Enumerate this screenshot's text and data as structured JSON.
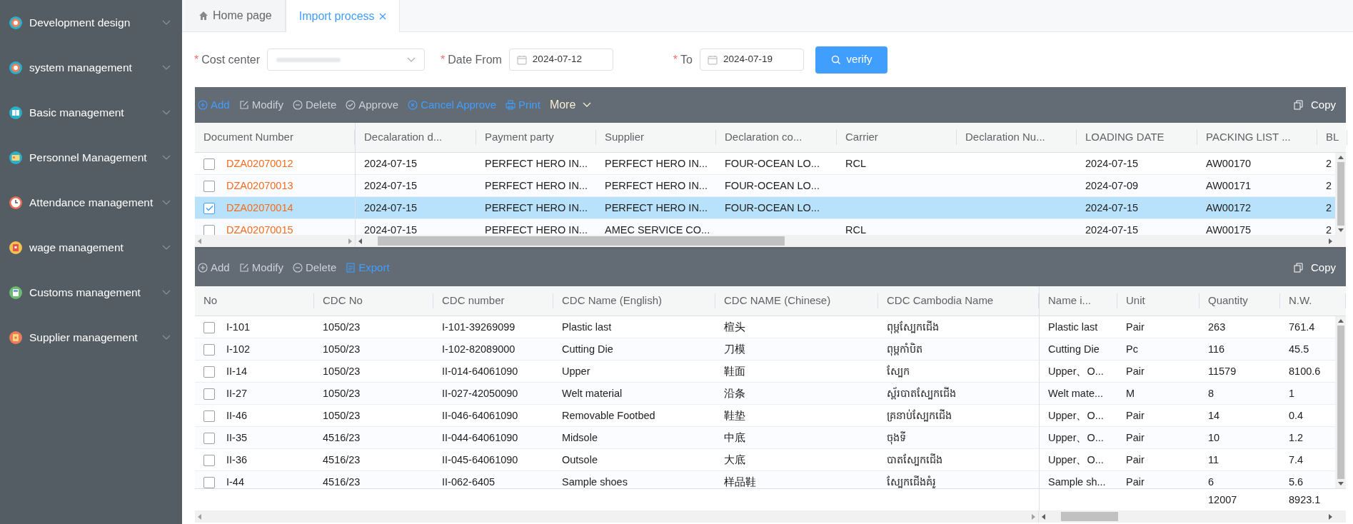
{
  "sidebar": {
    "items": [
      {
        "label": "Development design",
        "expanded": false
      },
      {
        "label": "system management",
        "expanded": false
      },
      {
        "label": "Basic management",
        "expanded": false
      },
      {
        "label": "Personnel Management",
        "expanded": false
      },
      {
        "label": "Attendance management",
        "expanded": false
      },
      {
        "label": "wage management",
        "expanded": false
      },
      {
        "label": "Customs management",
        "expanded": false
      },
      {
        "label": "Supplier management",
        "expanded": false
      }
    ]
  },
  "tabs": [
    {
      "label": "Home page",
      "selected": false,
      "kind": "home"
    },
    {
      "label": "Import process",
      "selected": true,
      "kind": "closable"
    }
  ],
  "filters": [
    {
      "label": "Cost center",
      "required_mark": "*",
      "kind": "select"
    },
    {
      "label": "Date From",
      "required_mark": "*",
      "kind": "date",
      "value": "2024-07-12"
    },
    {
      "label": "To",
      "required_mark": "*",
      "kind": "date",
      "value": "2024-07-19"
    }
  ],
  "verify_button": {
    "label": "verify"
  },
  "header_panel": {
    "toolbar": {
      "actions": [
        {
          "label": "Add",
          "kind": "add",
          "disabled": false
        },
        {
          "label": "Modify",
          "kind": "modify",
          "disabled": true
        },
        {
          "label": "Delete",
          "kind": "delete",
          "disabled": true
        },
        {
          "label": "Approve",
          "kind": "approve",
          "disabled": true
        },
        {
          "label": "Cancel Approve",
          "kind": "cancel",
          "disabled": false
        },
        {
          "label": "Print",
          "kind": "print",
          "disabled": false
        },
        {
          "label": "More",
          "kind": "more"
        }
      ],
      "copy": {
        "label": "Copy"
      }
    },
    "table": {
      "columns": [
        "Document Number",
        "Decalaration d...",
        "Payment party",
        "Supplier",
        "Declaration co...",
        "Carrier",
        "Declaration Nu...",
        "LOADING DATE",
        "PACKING LIST ...",
        "BL"
      ],
      "rows": [
        {
          "selected": false,
          "checked": false,
          "cells": [
            "DZA02070012",
            "2024-07-15",
            "PERFECT HERO IN...",
            "PERFECT HERO IN...",
            "FOUR-OCEAN LO...",
            "RCL",
            "",
            "2024-07-15",
            "AW00170",
            "2"
          ]
        },
        {
          "selected": false,
          "checked": false,
          "cells": [
            "DZA02070013",
            "2024-07-15",
            "PERFECT HERO IN...",
            "PERFECT HERO IN...",
            "FOUR-OCEAN LO...",
            "",
            "",
            "2024-07-09",
            "AW00171",
            "2"
          ]
        },
        {
          "selected": true,
          "checked": true,
          "cells": [
            "DZA02070014",
            "2024-07-15",
            "PERFECT HERO IN...",
            "PERFECT HERO IN...",
            "FOUR-OCEAN LO...",
            "",
            "",
            "2024-07-15",
            "AW00172",
            "2"
          ]
        },
        {
          "selected": false,
          "checked": false,
          "cells": [
            "DZA02070015",
            "2024-07-15",
            "PERFECT HERO IN...",
            "AMEC SERVICE CO...",
            "",
            "RCL",
            "",
            "2024-07-15",
            "AW00175",
            "2"
          ]
        }
      ]
    }
  },
  "detail_panel": {
    "toolbar": {
      "actions": [
        {
          "label": "Add",
          "kind": "add",
          "disabled": true
        },
        {
          "label": "Modify",
          "kind": "modify",
          "disabled": true
        },
        {
          "label": "Delete",
          "kind": "delete",
          "disabled": true
        },
        {
          "label": "Export",
          "kind": "export",
          "disabled": false
        }
      ],
      "copy": {
        "label": "Copy"
      }
    },
    "table": {
      "columns": [
        "No",
        "CDC No",
        "CDC number",
        "CDC Name (English)",
        "CDC NAME (Chinese)",
        "CDC Cambodia Name"
      ],
      "pinned_columns": [
        "Name i...",
        "Unit",
        "Quantity",
        "N.W."
      ],
      "rows": [
        {
          "checked": false,
          "cells": [
            "I-101",
            "1050/23",
            "I-101-39269099",
            "Plastic last",
            "楦头",
            "ពុម្ពស្បែកជើង",
            "Plastic last",
            "Pair",
            "263",
            "761.4"
          ]
        },
        {
          "checked": false,
          "cells": [
            "I-102",
            "1050/23",
            "I-102-82089000",
            "Cutting Die",
            "刀模",
            "ពុម្ពកាំបិត",
            "Cutting Die",
            "Pc",
            "116",
            "45.5"
          ]
        },
        {
          "checked": false,
          "cells": [
            "II-14",
            "1050/23",
            "II-014-64061090",
            "Upper",
            "鞋面",
            "ស្បែក",
            "Upper、O...",
            "Pair",
            "11579",
            "8100.6"
          ]
        },
        {
          "checked": false,
          "cells": [
            "II-27",
            "1050/23",
            "II-027-42050090",
            "Welt material",
            "沿条",
            "ស្ព័របាតស្បែកជើង",
            "Welt mate...",
            "M",
            "8",
            "1"
          ]
        },
        {
          "checked": false,
          "cells": [
            "II-46",
            "1050/23",
            "II-046-64061090",
            "Removable Footbed",
            "鞋垫",
            "គ្រនាប់ស្បែកជើង",
            "Upper、O...",
            "Pair",
            "14",
            "0.4"
          ]
        },
        {
          "checked": false,
          "cells": [
            "II-35",
            "4516/23",
            "II-044-64061090",
            "Midsole",
            "中底",
            "ចុងទី",
            "Upper、O...",
            "Pair",
            "10",
            "1.2"
          ]
        },
        {
          "checked": false,
          "cells": [
            "II-36",
            "4516/23",
            "II-045-64061090",
            "Outsole",
            "大底",
            "បាតស្បែកជើង",
            "Upper、O...",
            "Pair",
            "11",
            "7.4"
          ]
        },
        {
          "checked": false,
          "cells": [
            "I-44",
            "4516/23",
            "II-062-6405",
            "Sample shoes",
            "样品鞋",
            "ស្បែកជើងគំរូ",
            "Sample sh...",
            "Pair",
            "6",
            "5.6"
          ]
        }
      ],
      "summary_row": {
        "quantity": "12007",
        "n_w": "8923.1"
      }
    }
  }
}
